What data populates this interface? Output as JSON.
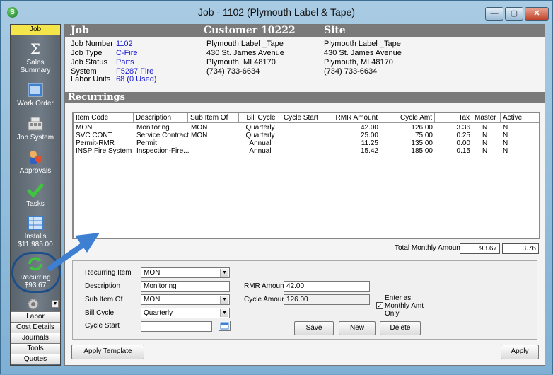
{
  "window": {
    "title": "Job - 1102 (Plymouth Label & Tape)",
    "app_icon_letter": "S",
    "minimize": "—",
    "restore": "▢",
    "close": "✕"
  },
  "sidebar": {
    "active_tab": "Job",
    "items": [
      {
        "label": "Sales\nSummary",
        "icon": "sigma-icon"
      },
      {
        "label": "Work Order",
        "icon": "work-order-icon"
      },
      {
        "label": "Job System",
        "icon": "job-system-icon"
      },
      {
        "label": "Approvals",
        "icon": "approvals-icon"
      },
      {
        "label": "Tasks",
        "icon": "tasks-icon"
      },
      {
        "label": "Installs\n$11,985.00",
        "icon": "installs-icon"
      },
      {
        "label": "Recurring\n$93.67",
        "icon": "recurring-icon"
      }
    ],
    "bottom_tabs": [
      "Labor",
      "Cost Details",
      "Journals",
      "Tools",
      "Quotes"
    ]
  },
  "header": {
    "job_heading": "Job",
    "customer_heading": "Customer 10222",
    "site_heading": "Site"
  },
  "job": {
    "fields": [
      {
        "label": "Job Number",
        "value": "1102"
      },
      {
        "label": "Job Type",
        "value": "C-Fire"
      },
      {
        "label": "Job Status",
        "value": "Parts"
      },
      {
        "label": "System",
        "value": "F5287 Fire"
      },
      {
        "label": "Labor Units",
        "value": "68 (0 Used)"
      }
    ]
  },
  "customer": {
    "lines": [
      "Plymouth Label _Tape",
      "430 St. James Avenue",
      "Plymouth, MI  48170",
      "(734) 733-6634"
    ]
  },
  "site": {
    "lines": [
      "Plymouth Label _Tape",
      "430 St. James Avenue",
      "Plymouth, MI  48170",
      "(734) 733-6634"
    ]
  },
  "recurrings": {
    "section_title": "Recurrings",
    "columns": [
      "Item Code",
      "Description",
      "Sub Item Of",
      "Bill Cycle",
      "Cycle Start",
      "RMR Amount",
      "Cycle Amt",
      "Tax",
      "Master",
      "Active"
    ],
    "rows": [
      [
        "MON",
        "Monitoring",
        "MON",
        "Quarterly",
        "",
        "42.00",
        "126.00",
        "3.36",
        "N",
        "N"
      ],
      [
        "SVC CONT",
        "Service Contract",
        "MON",
        "Quarterly",
        "",
        "25.00",
        "75.00",
        "0.25",
        "N",
        "N"
      ],
      [
        "Permit-RMR",
        "Permit",
        "",
        "Annual",
        "",
        "11.25",
        "135.00",
        "0.00",
        "N",
        "N"
      ],
      [
        "INSP Fire System",
        "Inspection-Fire...",
        "",
        "Annual",
        "",
        "15.42",
        "185.00",
        "0.15",
        "N",
        "N"
      ]
    ],
    "total_label": "Total Monthly Amount",
    "total_amount": "93.67",
    "total_tax": "3.76"
  },
  "editor": {
    "recurring_item_label": "Recurring Item",
    "recurring_item_value": "MON",
    "description_label": "Description",
    "description_value": "Monitoring",
    "sub_item_label": "Sub Item Of",
    "sub_item_value": "MON",
    "bill_cycle_label": "Bill Cycle",
    "bill_cycle_value": "Quarterly",
    "cycle_start_label": "Cycle Start",
    "cycle_start_value": "",
    "rmr_label": "RMR Amount",
    "rmr_value": "42.00",
    "cycle_amount_label": "Cycle Amount",
    "cycle_amount_value": "126.00",
    "enter_monthly_label": "Enter as Monthly Amt Only",
    "enter_monthly_checked": "✓",
    "save_label": "Save",
    "new_label": "New",
    "delete_label": "Delete"
  },
  "footer": {
    "apply_template_label": "Apply Template",
    "apply_label": "Apply"
  },
  "colors": {
    "highlight": "#f4e64a",
    "link_value": "#1a1ad6",
    "section_bar": "#7a7a7a",
    "annotation_arrow": "#3d7fd1"
  }
}
